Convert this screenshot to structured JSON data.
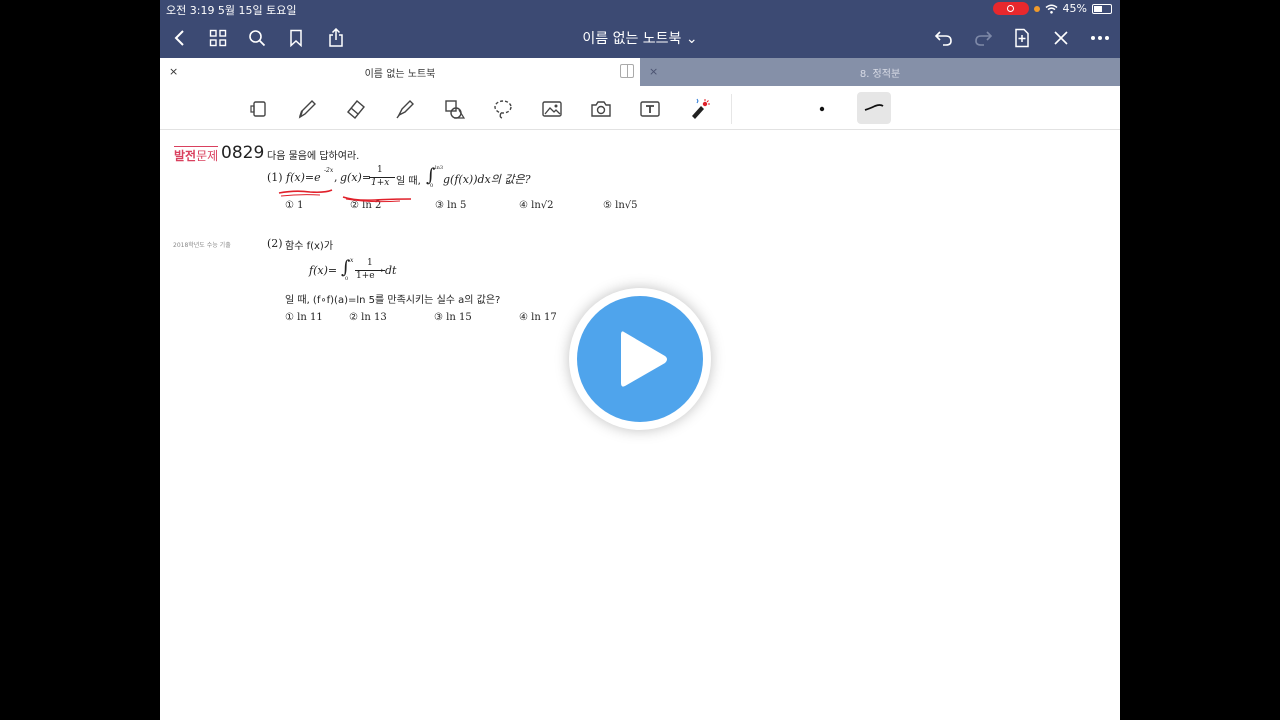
{
  "status_bar": {
    "time_date": "오전 3:19   5월 15일 토요일",
    "battery": "45%"
  },
  "nav": {
    "title": "이름 없는 노트북 ⌄",
    "icons": [
      "back-icon",
      "grid-icon",
      "search-icon",
      "bookmark-icon",
      "share-icon",
      "undo-icon",
      "redo-icon",
      "add-page-icon",
      "close-icon",
      "more-icon"
    ]
  },
  "tabs": {
    "active_label": "이름 없는 노트북",
    "inactive_label": "8. 정적분",
    "close_glyph": "×"
  },
  "toolbar": {
    "tools": [
      "page-tool-icon",
      "pen-icon",
      "eraser-icon",
      "highlighter-icon",
      "shapes-icon",
      "lasso-icon",
      "image-icon",
      "camera-icon",
      "text-icon",
      "laser-pointer-icon"
    ],
    "selected": "pen-stroke-style"
  },
  "problem": {
    "badge_1": "발전",
    "badge_2": "문제",
    "number": "0829",
    "instruction": "다음 물음에 답하여라.",
    "part1": {
      "label": "(1)",
      "f_def": "f(x)=e",
      "f_exp": "-2x",
      "comma": ",",
      "g_def": "g(x)=",
      "g_num": "1",
      "g_den": "1+x",
      "cond": "일 때,",
      "int_upper": "ln3",
      "int_lower": "0",
      "integrand": "g(f(x))dx의 값은?",
      "choices": [
        "① 1",
        "② ln 2",
        "③ ln 5",
        "④ ln√2",
        "⑤ ln√5"
      ]
    },
    "part2": {
      "source": "2018학년도 수능 기출",
      "label": "(2)",
      "statement": "함수 f(x)가",
      "def_lhs": "f(x)=",
      "int_upper": "x",
      "int_lower": "0",
      "frac_num": "1",
      "frac_den": "1+e",
      "frac_den_exp": "-t",
      "dt": "dt",
      "condition": "일 때, (f∘f)(a)=ln 5를 만족시키는 실수 a의 값은?",
      "choices": [
        "① ln 11",
        "② ln 13",
        "③ ln 15",
        "④ ln 17"
      ]
    }
  },
  "colors": {
    "nav_bg": "#3c4a73",
    "accent_red": "#d9405e",
    "ink_red": "#e0202a",
    "play_blue": "#4fa4ec"
  }
}
